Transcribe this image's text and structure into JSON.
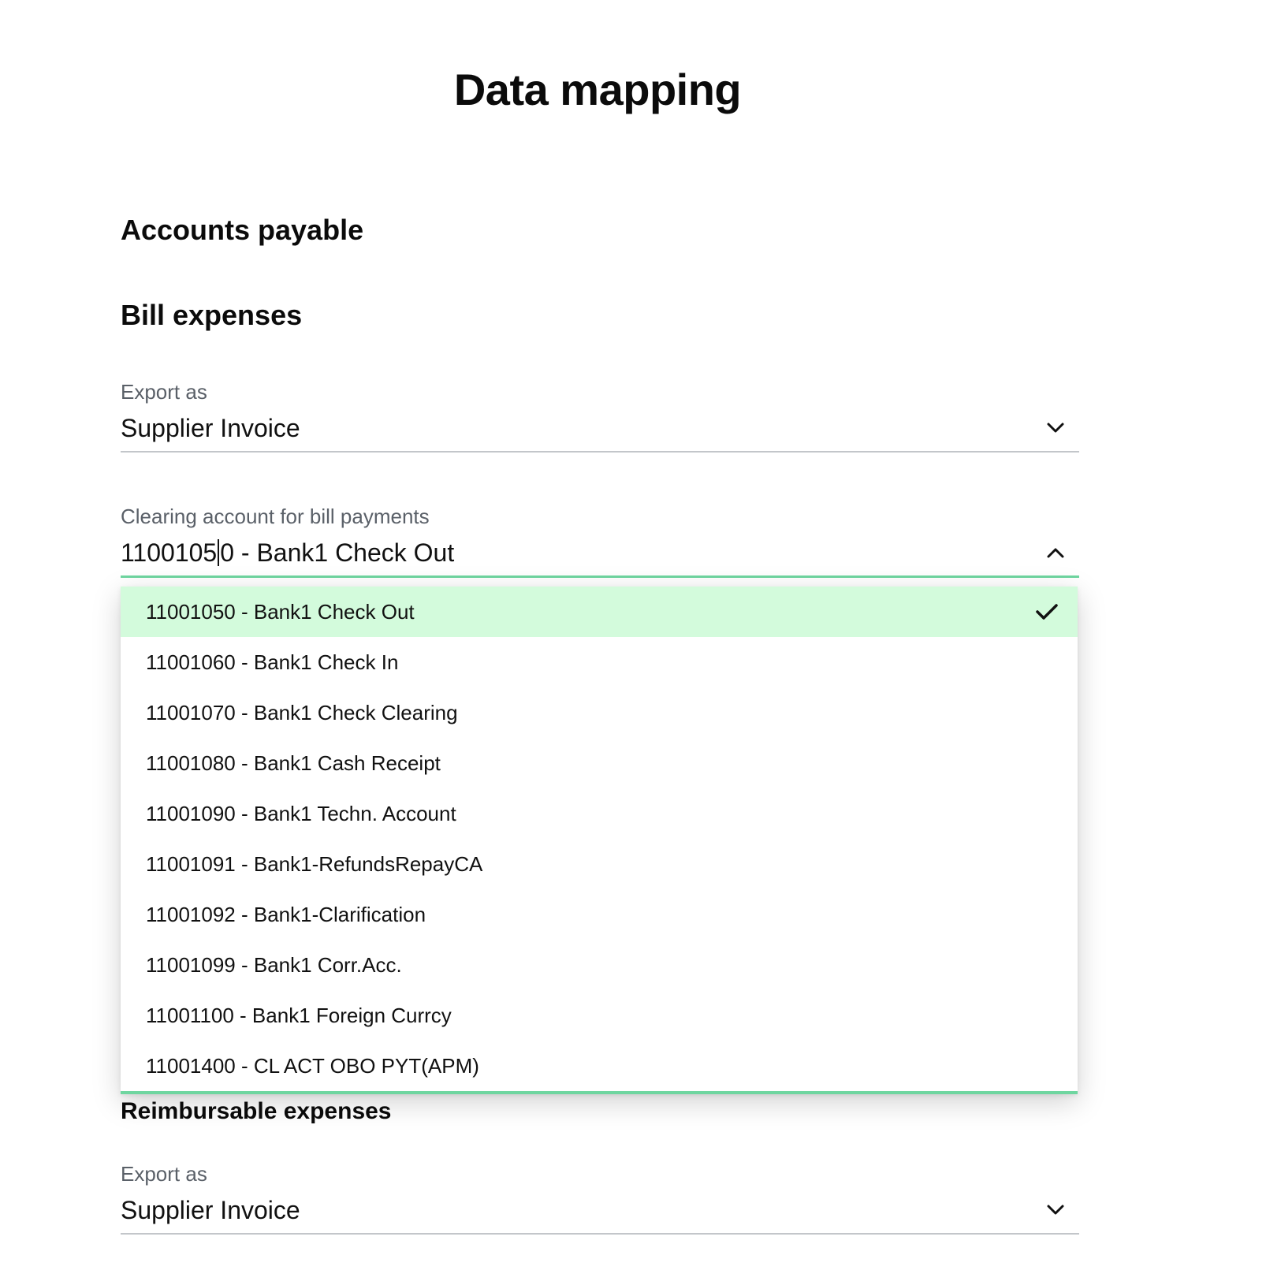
{
  "page": {
    "title": "Data mapping"
  },
  "accounts_payable": {
    "title": "Accounts payable"
  },
  "bill_expenses": {
    "title": "Bill expenses",
    "export_as": {
      "label": "Export as",
      "value": "Supplier Invoice"
    },
    "clearing_account": {
      "label": "Clearing account for bill payments",
      "value_before_cursor": "1100105",
      "value_after_cursor": "0 - Bank1 Check Out",
      "options": [
        {
          "label": "11001050 - Bank1 Check Out",
          "selected": true
        },
        {
          "label": "11001060 - Bank1 Check In",
          "selected": false
        },
        {
          "label": "11001070 - Bank1 Check Clearing",
          "selected": false
        },
        {
          "label": "11001080 - Bank1 Cash Receipt",
          "selected": false
        },
        {
          "label": "11001090 - Bank1 Techn. Account",
          "selected": false
        },
        {
          "label": "11001091 - Bank1-RefundsRepayCA",
          "selected": false
        },
        {
          "label": "11001092 - Bank1-Clarification",
          "selected": false
        },
        {
          "label": "11001099 - Bank1 Corr.Acc.",
          "selected": false
        },
        {
          "label": "11001100 - Bank1 Foreign Currcy",
          "selected": false
        },
        {
          "label": "11001400 - CL ACT OBO PYT(APM)",
          "selected": false
        }
      ]
    }
  },
  "reimbursable_expenses": {
    "title": "Reimbursable expenses",
    "export_as": {
      "label": "Export as",
      "value": "Supplier Invoice"
    }
  },
  "icons": {
    "dropdown_closed": "chevron-down-icon",
    "dropdown_open": "chevron-up-icon",
    "selected_option": "checkmark-icon"
  },
  "colors": {
    "accent_border": "#6fd6a0",
    "selected_option_bg": "#d3fbdc",
    "label_text": "#5a6068",
    "divider": "#c3c6ca"
  }
}
